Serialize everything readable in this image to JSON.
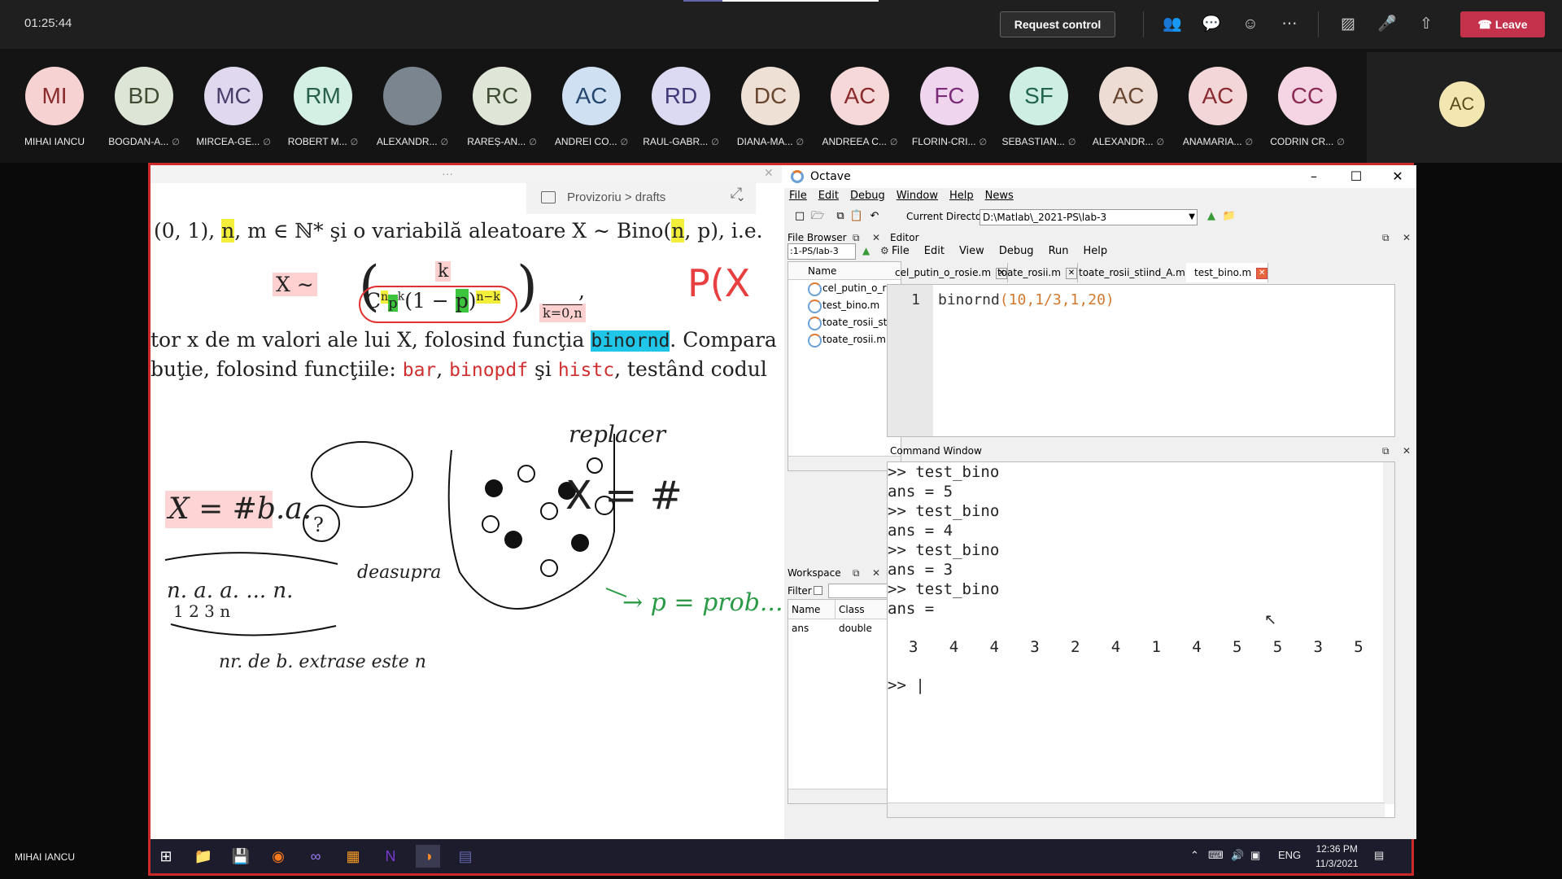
{
  "meeting": {
    "timer": "01:25:44",
    "request_control": "Request control",
    "leave": "Leave",
    "presenter_label": "MIHAI IANCU"
  },
  "participants": [
    {
      "initials": "MI",
      "name": "MIHAI IANCU",
      "bg": "#f6d2d2",
      "fg": "#8a2b2b"
    },
    {
      "initials": "BD",
      "name": "BOGDAN-A...",
      "bg": "#dde5d6",
      "fg": "#3e4d33"
    },
    {
      "initials": "MC",
      "name": "MIRCEA-GE...",
      "bg": "#e0d8ef",
      "fg": "#4a3d6b"
    },
    {
      "initials": "RM",
      "name": "ROBERT M...",
      "bg": "#d4efe4",
      "fg": "#27614a"
    },
    {
      "initials": "",
      "name": "ALEXANDR...",
      "bg": "#7a8590",
      "fg": "#fff"
    },
    {
      "initials": "RC",
      "name": "RAREȘ-AN...",
      "bg": "#dfe6d8",
      "fg": "#3e4d33"
    },
    {
      "initials": "AC",
      "name": "ANDREI CO...",
      "bg": "#cfe0f3",
      "fg": "#23476e"
    },
    {
      "initials": "RD",
      "name": "RAUL-GABR...",
      "bg": "#dcd9f2",
      "fg": "#3f3a78"
    },
    {
      "initials": "DC",
      "name": "DIANA-MA...",
      "bg": "#eee0d5",
      "fg": "#6a4631"
    },
    {
      "initials": "AC",
      "name": "ANDREEA C...",
      "bg": "#f6d8d8",
      "fg": "#8a2b2b"
    },
    {
      "initials": "FC",
      "name": "FLORIN-CRI...",
      "bg": "#f0d5ef",
      "fg": "#7a2c78"
    },
    {
      "initials": "SF",
      "name": "SEBASTIAN...",
      "bg": "#cfeee3",
      "fg": "#22654d"
    },
    {
      "initials": "AC",
      "name": "ALEXANDR...",
      "bg": "#ecdcd4",
      "fg": "#6a4631"
    },
    {
      "initials": "AC",
      "name": "ANAMARIA...",
      "bg": "#f2d6d8",
      "fg": "#8a2b32"
    },
    {
      "initials": "CC",
      "name": "CODRIN CR...",
      "bg": "#f5d5e3",
      "fg": "#8a2b55"
    }
  ],
  "self_initials": "AC",
  "notes": {
    "breadcrumb": "Provizoriu > drafts",
    "line1_a": "(0, 1), ",
    "line1_n": "n",
    "line1_b": ", m ∈ ℕ* şi o variabilă aleatoare X ∼ Bino(",
    "line1_n2": "n",
    "line1_c": ", p), i.e.",
    "formula_x": "X ∼",
    "formula_body": "C",
    "formula_mid": "(1 − ",
    "formula_p": "p",
    "formula_exp": "n−k",
    "formula_sub": "k=0,n",
    "formula_k": "k",
    "line2_a": "tor x de m valori ale lui X, folosind funcţia ",
    "line2_code": "binornd",
    "line2_b": ". Compara",
    "line3_a": "buţie, folosind funcţiile: ",
    "line3_bar": "bar",
    "line3_binopdf": "binopdf",
    "line3_si": " şi ",
    "line3_histc": "histc",
    "line3_b": ", testând codul",
    "hw_replace": "replacer",
    "hw_x_eq": "X = #",
    "hw_x_def": "X = #b.a.",
    "hw_seq": "n.  a.  a. ...  n.",
    "hw_seq_idx": "1    2    3          n",
    "hw_caption": "nr. de b. extrase este n",
    "hw_deasupra": "deasupra",
    "hw_prob": "→ p = prob...",
    "hw_pcx": "P(X",
    "hw_question": "?"
  },
  "octave": {
    "title": "Octave",
    "menu": [
      "File",
      "Edit",
      "Debug",
      "Window",
      "Help",
      "News"
    ],
    "current_dir_label": "Current Directory:",
    "current_dir": "D:\\Matlab\\_2021-PS\\lab-3",
    "file_browser_title": "File Browser",
    "fb_path": ":1-PS/lab-3",
    "fb_col": "Name",
    "files": [
      "cel_putin_o_rc",
      "test_bino.m",
      "toate_rosii_stii",
      "toate_rosii.m"
    ],
    "workspace_title": "Workspace",
    "filter_label": "Filter",
    "ws_cols": [
      "Name",
      "Class"
    ],
    "ws_rows": [
      [
        "ans",
        "double"
      ]
    ],
    "editor_title": "Editor",
    "editor_menu": [
      "File",
      "Edit",
      "View",
      "Debug",
      "Run",
      "Help"
    ],
    "tabs": [
      "cel_putin_o_rosie.m",
      "toate_rosii.m",
      "toate_rosii_stiind_A.m",
      "test_bino.m"
    ],
    "line_no": "1",
    "code": "binornd(10,1/3,1,20)",
    "command_window_title": "Command Window",
    "cmd_lines": [
      ">> test_bino",
      "ans = 5",
      ">> test_bino",
      "ans = 4",
      ">> test_bino",
      "ans = 3",
      ">> test_bino",
      "ans ="
    ],
    "result_values": [
      "3",
      "4",
      "4",
      "3",
      "2",
      "4",
      "1",
      "4",
      "5",
      "5",
      "3",
      "5"
    ],
    "prompt": ">> |"
  },
  "taskbar": {
    "lang": "ENG",
    "time": "12:36 PM",
    "date": "11/3/2021"
  }
}
